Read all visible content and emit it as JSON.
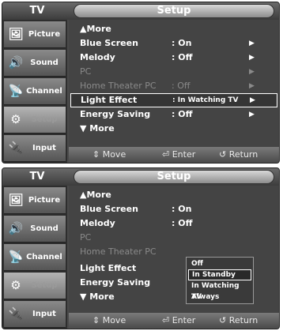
{
  "panels": [
    {
      "title": "TV",
      "header": "Setup",
      "sidebar": [
        {
          "label": "Picture",
          "icon": "🖼"
        },
        {
          "label": "Sound",
          "icon": "🔊"
        },
        {
          "label": "Channel",
          "icon": "📡"
        },
        {
          "label": "Setup",
          "icon": "⚙"
        },
        {
          "label": "Input",
          "icon": "🔌"
        }
      ],
      "rows": [
        {
          "label": "▲More",
          "value": "",
          "arrow": ""
        },
        {
          "label": "Blue Screen",
          "value": ": On",
          "arrow": "▶"
        },
        {
          "label": "Melody",
          "value": ": Off",
          "arrow": "▶"
        },
        {
          "label": "PC",
          "value": "",
          "arrow": "▶"
        },
        {
          "label": "Home Theater PC",
          "value": ": Off",
          "arrow": "▶"
        },
        {
          "label": "Light Effect",
          "value": ": In Watching TV",
          "arrow": "▶"
        },
        {
          "label": "Energy  Saving",
          "value": ": Off",
          "arrow": "▶"
        },
        {
          "label": "▼ More",
          "value": "",
          "arrow": ""
        }
      ],
      "bottom": {
        "move": "⇕ Move",
        "enter": "⏎ Enter",
        "return": "↺ Return"
      }
    },
    {
      "title": "TV",
      "header": "Setup",
      "sidebar": [
        {
          "label": "Picture",
          "icon": "🖼"
        },
        {
          "label": "Sound",
          "icon": "🔊"
        },
        {
          "label": "Channel",
          "icon": "📡"
        },
        {
          "label": "Setup",
          "icon": "⚙"
        },
        {
          "label": "Input",
          "icon": "🔌"
        }
      ],
      "rows": [
        {
          "label": "▲More",
          "value": ""
        },
        {
          "label": "Blue Screen",
          "value": ": On"
        },
        {
          "label": "Melody",
          "value": ": Off"
        },
        {
          "label": "PC",
          "value": ""
        },
        {
          "label": "Home Theater PC",
          "value": ""
        },
        {
          "label": "Light Effect",
          "value": ""
        },
        {
          "label": "Energy  Saving",
          "value": ""
        },
        {
          "label": "▼ More",
          "value": ""
        }
      ],
      "dropdown": [
        "Off",
        "In Standby",
        "In Watching TV",
        "Always"
      ],
      "bottom": {
        "move": "⇕ Move",
        "enter": "⏎ Enter",
        "return": "↺ Return"
      }
    }
  ]
}
